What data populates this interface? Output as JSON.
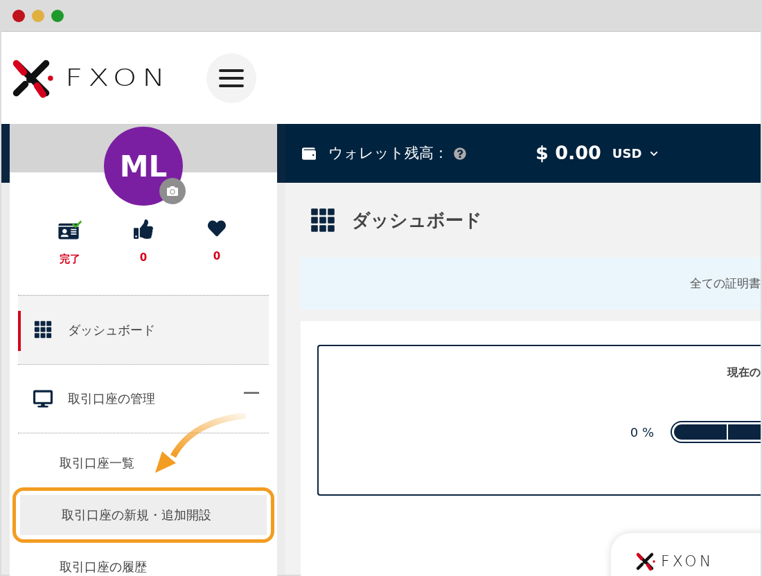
{
  "header": {
    "logo_text": "FXON"
  },
  "profile": {
    "initials": "ML",
    "stats": [
      {
        "kind": "verified",
        "label": "完了"
      },
      {
        "kind": "likes",
        "label": "0"
      },
      {
        "kind": "favorites",
        "label": "0"
      }
    ]
  },
  "sidebar": {
    "items": [
      {
        "kind": "dashboard",
        "label": "ダッシュボード",
        "selected": true
      },
      {
        "kind": "accounts",
        "label": "取引口座の管理",
        "selected": false,
        "expanded": true,
        "children": [
          {
            "label": "取引口座一覧",
            "selected": false,
            "highlighted": false
          },
          {
            "label": "取引口座の新規・追加開設",
            "selected": true,
            "highlighted": true
          },
          {
            "label": "取引口座の履歴",
            "selected": false,
            "highlighted": false
          }
        ]
      }
    ]
  },
  "wallet": {
    "label": "ウォレット残高：",
    "amount": "$ 0.00",
    "currency": "USD"
  },
  "page": {
    "title": "ダッシュボード",
    "notice": "全ての証明書",
    "card_title": "現在の",
    "progress": {
      "reading": "0 %",
      "level": 0
    }
  },
  "footer_card": {
    "logo_text": "FXON"
  }
}
